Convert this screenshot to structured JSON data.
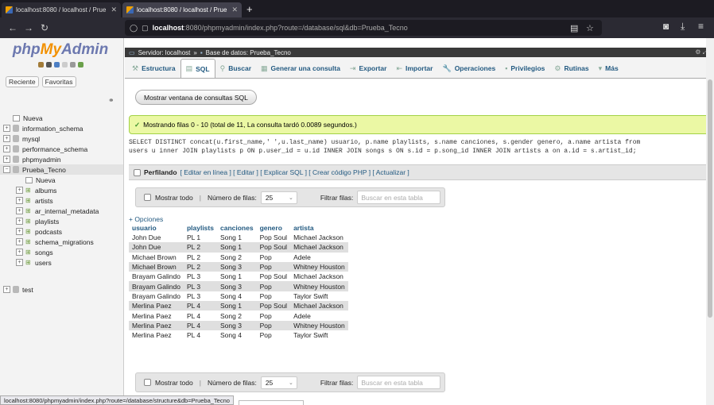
{
  "browser": {
    "tabs": [
      {
        "title": "localhost:8080 / localhost / Prue",
        "active": false
      },
      {
        "title": "localhost:8080 / localhost / Prue",
        "active": true
      }
    ],
    "url_host": "localhost",
    "url_rest": ":8080/phpmyadmin/index.php?route=/database/sql&db=Prueba_Tecno",
    "status_url": "localhost:8080/phpmyadmin/index.php?route=/database/structure&db=Prueba_Tecno"
  },
  "sidebar": {
    "logo_php": "php",
    "logo_my": "My",
    "logo_admin": "Admin",
    "recent": "Reciente",
    "favorites": "Favoritas",
    "tree": [
      {
        "label": "Nueva",
        "kind": "new",
        "indent": 0
      },
      {
        "label": "information_schema",
        "kind": "db",
        "indent": 0
      },
      {
        "label": "mysql",
        "kind": "db",
        "indent": 0
      },
      {
        "label": "performance_schema",
        "kind": "db",
        "indent": 0
      },
      {
        "label": "phpmyadmin",
        "kind": "db",
        "indent": 0
      },
      {
        "label": "Prueba_Tecno",
        "kind": "db-open",
        "indent": 0
      },
      {
        "label": "Nueva",
        "kind": "new",
        "indent": 1
      },
      {
        "label": "albums",
        "kind": "table",
        "indent": 1
      },
      {
        "label": "artists",
        "kind": "table",
        "indent": 1
      },
      {
        "label": "ar_internal_metadata",
        "kind": "table",
        "indent": 1
      },
      {
        "label": "playlists",
        "kind": "table",
        "indent": 1
      },
      {
        "label": "podcasts",
        "kind": "table",
        "indent": 1
      },
      {
        "label": "schema_migrations",
        "kind": "table",
        "indent": 1
      },
      {
        "label": "songs",
        "kind": "table",
        "indent": 1
      },
      {
        "label": "users",
        "kind": "table",
        "indent": 1
      },
      {
        "label": "test",
        "kind": "db",
        "indent": 0
      }
    ]
  },
  "breadcrumb": {
    "server": "Servidor: localhost",
    "sep": "»",
    "database": "Base de datos: Prueba_Tecno"
  },
  "main_tabs": [
    {
      "label": "Estructura",
      "icon": "structure-icon",
      "glyph": "⚒"
    },
    {
      "label": "SQL",
      "icon": "sql-icon",
      "glyph": "▤",
      "active": true
    },
    {
      "label": "Buscar",
      "icon": "search-icon",
      "glyph": "⚲"
    },
    {
      "label": "Generar una consulta",
      "icon": "query-icon",
      "glyph": "▦"
    },
    {
      "label": "Exportar",
      "icon": "export-icon",
      "glyph": "⇥"
    },
    {
      "label": "Importar",
      "icon": "import-icon",
      "glyph": "⇤"
    },
    {
      "label": "Operaciones",
      "icon": "wrench-icon",
      "glyph": "🔧"
    },
    {
      "label": "Privilegios",
      "icon": "privileges-icon",
      "glyph": "▪"
    },
    {
      "label": "Rutinas",
      "icon": "routines-icon",
      "glyph": "⚙"
    },
    {
      "label": "Más",
      "icon": "more-icon",
      "glyph": "▾"
    }
  ],
  "console_button": "Mostrar ventana de consultas SQL",
  "success_message": "Mostrando filas 0 - 10 (total de 11, La consulta tardó 0.0089 segundos.)",
  "sql_line1": "SELECT DISTINCT concat(u.first_name,' ',u.last_name) usuario, p.name playlists, s.name canciones, s.gender genero, a.name artista from",
  "sql_line2": "users u inner JOIN playlists p ON p.user_id = u.id INNER JOIN songs s ON s.id = p.song_id INNER JOIN artists a on a.id = s.artist_id;",
  "profiling": {
    "label": "Perfilando",
    "links": "[ Editar en línea ] [ Editar ] [ Explicar SQL ] [ Crear código PHP ] [ Actualizar ]"
  },
  "nav_controls": {
    "show_all": "Mostrar todo",
    "rows_label": "Número de filas:",
    "rows_value": "25",
    "filter_label": "Filtrar filas:",
    "filter_placeholder": "Buscar en esta tabla"
  },
  "options_link": "+ Opciones",
  "table": {
    "headers": [
      "usuario",
      "playlists",
      "canciones",
      "genero",
      "artista"
    ],
    "rows": [
      [
        "John Due",
        "PL 1",
        "Song 1",
        "Pop Soul",
        "Michael Jackson"
      ],
      [
        "John Due",
        "PL 2",
        "Song 1",
        "Pop Soul",
        "Michael Jackson"
      ],
      [
        "Michael Brown",
        "PL 2",
        "Song 2",
        "Pop",
        "Adele"
      ],
      [
        "Michael Brown",
        "PL 2",
        "Song 3",
        "Pop",
        "Whitney Houston"
      ],
      [
        "Brayam Galindo",
        "PL 3",
        "Song 1",
        "Pop Soul",
        "Michael Jackson"
      ],
      [
        "Brayam Galindo",
        "PL 3",
        "Song 3",
        "Pop",
        "Whitney Houston"
      ],
      [
        "Brayam Galindo",
        "PL 3",
        "Song 4",
        "Pop",
        "Taylor Swift"
      ],
      [
        "Merlina Paez",
        "PL 4",
        "Song 1",
        "Pop Soul",
        "Michael Jackson"
      ],
      [
        "Merlina Paez",
        "PL 4",
        "Song 2",
        "Pop",
        "Adele"
      ],
      [
        "Merlina Paez",
        "PL 4",
        "Song 3",
        "Pop",
        "Whitney Houston"
      ],
      [
        "Merlina Paez",
        "PL 4",
        "Song 4",
        "Pop",
        "Taylor Swift"
      ]
    ]
  }
}
